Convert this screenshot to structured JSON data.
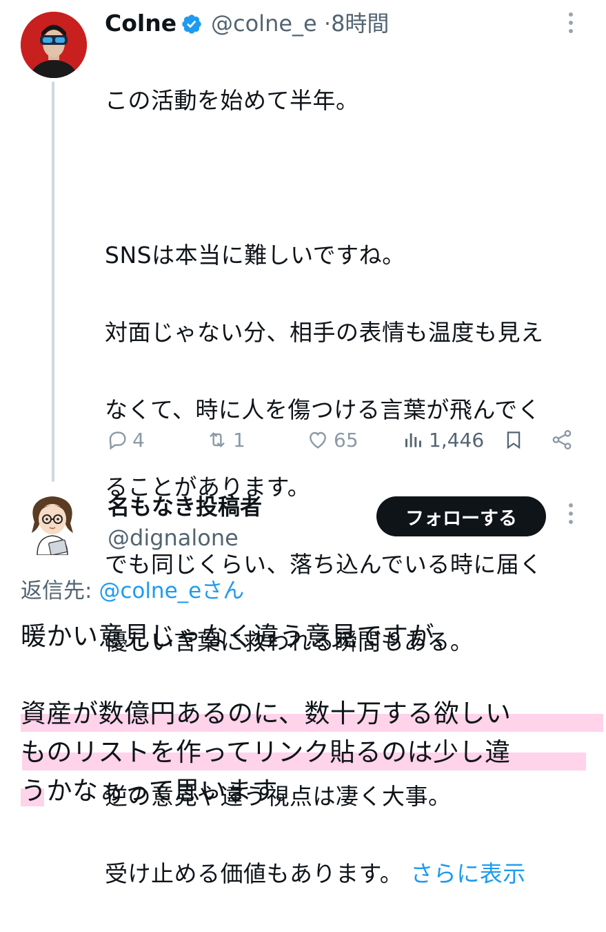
{
  "original_tweet": {
    "display_name": "Colne",
    "handle": "@colne_e",
    "separator": "·",
    "time": "8時間",
    "lines": [
      "この活動を始めて半年。",
      "",
      "SNSは本当に難しいですね。",
      "対面じゃない分、相手の表情も温度も見え",
      "なくて、時に人を傷つける言葉が飛んでく",
      "ることがあります。",
      "でも同じくらい、落ち込んでいる時に届く",
      "優しい言葉に救われる瞬間もある。",
      "",
      "逆の意見や違う視点は凄く大事。",
      "受け止める価値もあります。"
    ],
    "show_more": "さらに表示",
    "stats": {
      "replies": "4",
      "reposts": "1",
      "likes": "65",
      "views": "1,446"
    }
  },
  "reply": {
    "display_name": "名もなき投稿者",
    "handle": "@dignalone",
    "follow_label": "フォローする",
    "reply_to_prefix": "返信先: ",
    "reply_to_mention": "@colne_eさん",
    "lines": [
      "暖かい意見じゃなく違う意見ですが、",
      "",
      "資産が数億円あるのに、数十万する欲しい",
      "ものリストを作ってリンク貼るのは少し違",
      "うかなぁって思います。"
    ],
    "highlighted_lines": [
      2,
      3,
      4
    ]
  },
  "colors": {
    "link": "#1d9bf0",
    "secondary_text": "#536471",
    "highlight": "#ffb3d9",
    "follow_button": "#0f1419"
  }
}
